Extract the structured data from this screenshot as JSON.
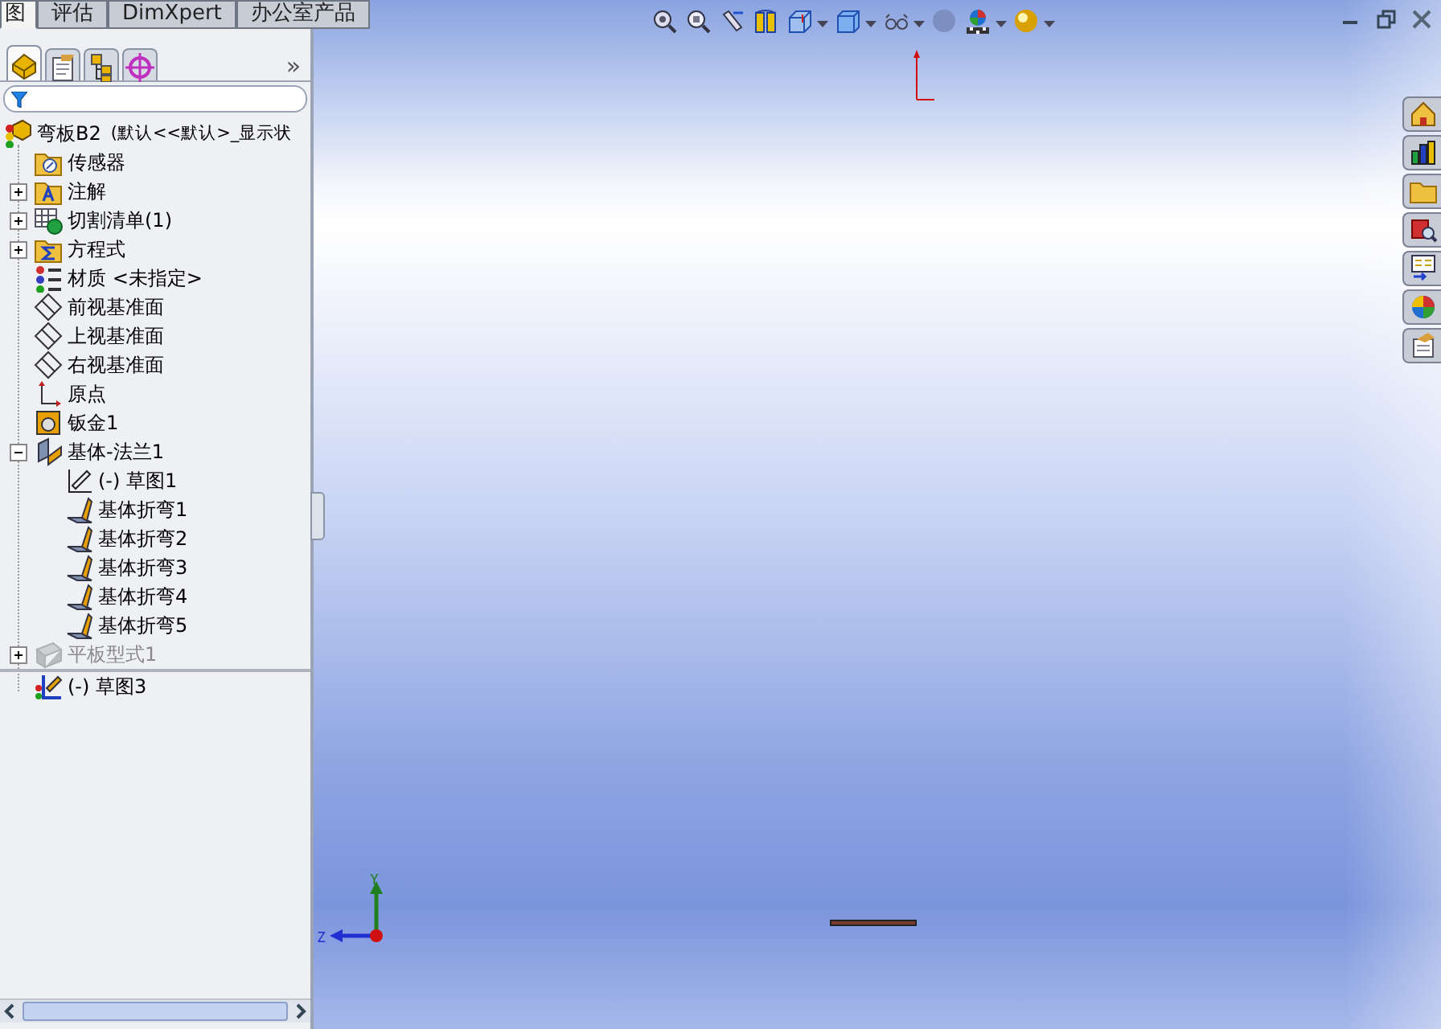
{
  "command_tabs": [
    {
      "label": "图",
      "selected": true
    },
    {
      "label": "评估",
      "selected": false
    },
    {
      "label": "DimXpert",
      "selected": false
    },
    {
      "label": "办公室产品",
      "selected": false
    }
  ],
  "panel_tabs": [
    {
      "kind": "feature",
      "selected": true
    },
    {
      "kind": "property",
      "selected": false
    },
    {
      "kind": "config",
      "selected": false
    },
    {
      "kind": "target",
      "selected": false
    }
  ],
  "panel_more": "»",
  "tree": {
    "kind": "part",
    "label": "弯板B2",
    "config_text": "(默认<<默认>_显示状",
    "children": [
      {
        "kind": "sensor",
        "label": "传感器",
        "suppressed": false,
        "after_rollback": false
      },
      {
        "kind": "annotation",
        "label": "注解",
        "expanded": false,
        "suppressed": false,
        "after_rollback": false
      },
      {
        "kind": "cutlist",
        "label": "切割清单(1)",
        "expanded": false,
        "suppressed": false,
        "after_rollback": false
      },
      {
        "kind": "equation",
        "label": "方程式",
        "expanded": false,
        "suppressed": false,
        "after_rollback": false
      },
      {
        "kind": "material",
        "label": "材质 <未指定>",
        "suppressed": false,
        "after_rollback": false
      },
      {
        "kind": "plane",
        "label": "前视基准面",
        "suppressed": false,
        "after_rollback": false
      },
      {
        "kind": "plane",
        "label": "上视基准面",
        "suppressed": false,
        "after_rollback": false
      },
      {
        "kind": "plane",
        "label": "右视基准面",
        "suppressed": false,
        "after_rollback": false
      },
      {
        "kind": "origin",
        "label": "原点",
        "suppressed": false,
        "after_rollback": false
      },
      {
        "kind": "sheetmetal",
        "label": "钣金1",
        "suppressed": false,
        "after_rollback": false
      },
      {
        "kind": "flange",
        "label": "基体-法兰1",
        "expanded": true,
        "suppressed": false,
        "after_rollback": false,
        "children": [
          {
            "kind": "sketch",
            "label": "(-) 草图1",
            "suppressed": false,
            "after_rollback": false
          },
          {
            "kind": "bend",
            "label": "基体折弯1",
            "suppressed": false,
            "after_rollback": false
          },
          {
            "kind": "bend",
            "label": "基体折弯2",
            "suppressed": false,
            "after_rollback": false
          },
          {
            "kind": "bend",
            "label": "基体折弯3",
            "suppressed": false,
            "after_rollback": false
          },
          {
            "kind": "bend",
            "label": "基体折弯4",
            "suppressed": false,
            "after_rollback": false
          },
          {
            "kind": "bend",
            "label": "基体折弯5",
            "suppressed": false,
            "after_rollback": false
          }
        ]
      },
      {
        "kind": "flat",
        "label": "平板型式1",
        "expanded": false,
        "suppressed": true,
        "after_rollback": false
      },
      {
        "kind": "sketch3d",
        "label": "(-) 草图3",
        "suppressed": false,
        "after_rollback": true
      }
    ]
  },
  "view_toolbar": [
    {
      "kind": "zoom-fit",
      "dropdown": false
    },
    {
      "kind": "zoom-area",
      "dropdown": false
    },
    {
      "kind": "previous",
      "dropdown": false
    },
    {
      "kind": "section",
      "dropdown": false
    },
    {
      "kind": "orientation",
      "dropdown": true
    },
    {
      "kind": "display",
      "dropdown": true
    },
    {
      "kind": "hide",
      "dropdown": true
    },
    {
      "kind": "appearance",
      "dropdown": false
    },
    {
      "kind": "scene",
      "dropdown": true
    },
    {
      "kind": "lights",
      "dropdown": true
    }
  ],
  "task_pane": [
    {
      "kind": "home"
    },
    {
      "kind": "library"
    },
    {
      "kind": "folder"
    },
    {
      "kind": "search"
    },
    {
      "kind": "palette"
    },
    {
      "kind": "colors"
    },
    {
      "kind": "notes"
    }
  ],
  "triad": {
    "y_label": "Y",
    "z_label": "Z"
  }
}
